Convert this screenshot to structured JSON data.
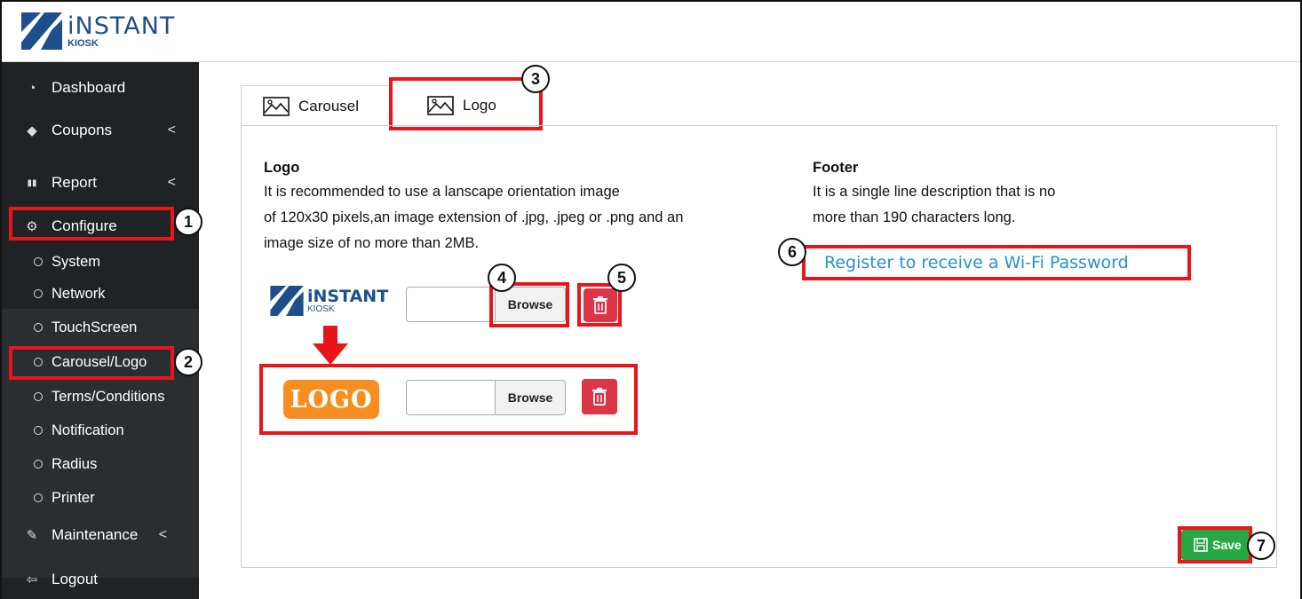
{
  "brand": {
    "name": "iNSTANT",
    "sub": "KIOSK"
  },
  "sidebar": {
    "items": [
      {
        "label": "Dashboard",
        "icon": "gauge-icon",
        "glyph": "◔"
      },
      {
        "label": "Coupons",
        "icon": "tag-icon",
        "glyph": "◆",
        "chevron": "<"
      },
      {
        "label": "Report",
        "icon": "bar-chart-icon",
        "glyph": "▮▮",
        "chevron": "<"
      },
      {
        "label": "Configure",
        "icon": "gear-icon",
        "glyph": "⚙"
      },
      {
        "label": "Maintenance",
        "icon": "wrench-icon",
        "glyph": "✎",
        "chevron": "<"
      },
      {
        "label": "Logout",
        "icon": "logout-icon",
        "glyph": "⇦"
      }
    ],
    "subitems": [
      "System",
      "Network",
      "TouchScreen",
      "Carousel/Logo",
      "Terms/Conditions",
      "Notification",
      "Radius",
      "Printer"
    ]
  },
  "tabs": [
    {
      "label": "Carousel"
    },
    {
      "label": "Logo"
    }
  ],
  "logo_section": {
    "title": "Logo",
    "desc_lines": [
      "It is recommended to use a lanscape orientation image",
      "of 120x30 pixels,an image extension of .jpg, .jpeg or .png and an",
      "image size of no more than 2MB."
    ],
    "browse_label": "Browse",
    "preview_text": "LOGO"
  },
  "footer_section": {
    "title": "Footer",
    "desc_lines": [
      "It is a single line description that is no",
      "more than 190 characters long."
    ],
    "value": "Register to receive a Wi-Fi Password"
  },
  "save_label": "Save",
  "badges": [
    "1",
    "2",
    "3",
    "4",
    "5",
    "6",
    "7"
  ],
  "colors": {
    "accent_red": "#e8151b",
    "save_green": "#28a745",
    "delete_red": "#dc3545",
    "link_blue": "#2a8fcf",
    "logo_orange": "#f78d1e",
    "sidebar_bg": "#1f2326"
  }
}
